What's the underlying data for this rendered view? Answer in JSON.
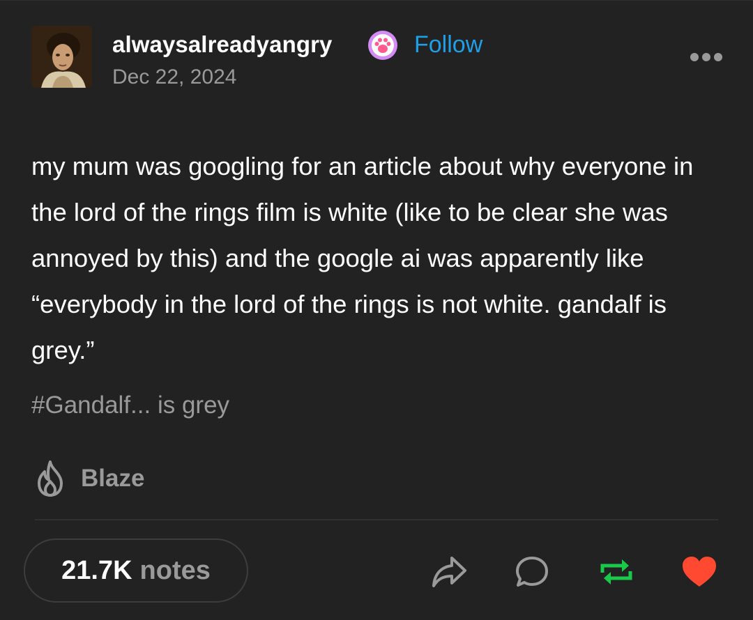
{
  "post": {
    "author": {
      "username": "alwaysalreadyangry",
      "avatar_icon": "portrait-avatar",
      "badge_icon": "paw-badge-icon"
    },
    "follow_label": "Follow",
    "date": "Dec 22, 2024",
    "body": "my mum was googling for an article about why everyone in the lord of the rings film is white (like to be clear she was annoyed by this) and the google ai was apparently like “everybody in the lord of the rings is not white. gandalf is grey.”",
    "tag": "#Gandalf... is grey",
    "blaze_label": "Blaze",
    "notes": {
      "count": "21.7K",
      "label": "notes"
    },
    "actions": [
      "share-icon",
      "reply-icon",
      "reblog-icon",
      "like-icon"
    ]
  },
  "colors": {
    "background": "#222222",
    "follow": "#1fa0e6",
    "muted_text": "#9a9a9a",
    "reblog": "#19c94a",
    "like": "#ff4930",
    "badge": "#c77dff"
  }
}
